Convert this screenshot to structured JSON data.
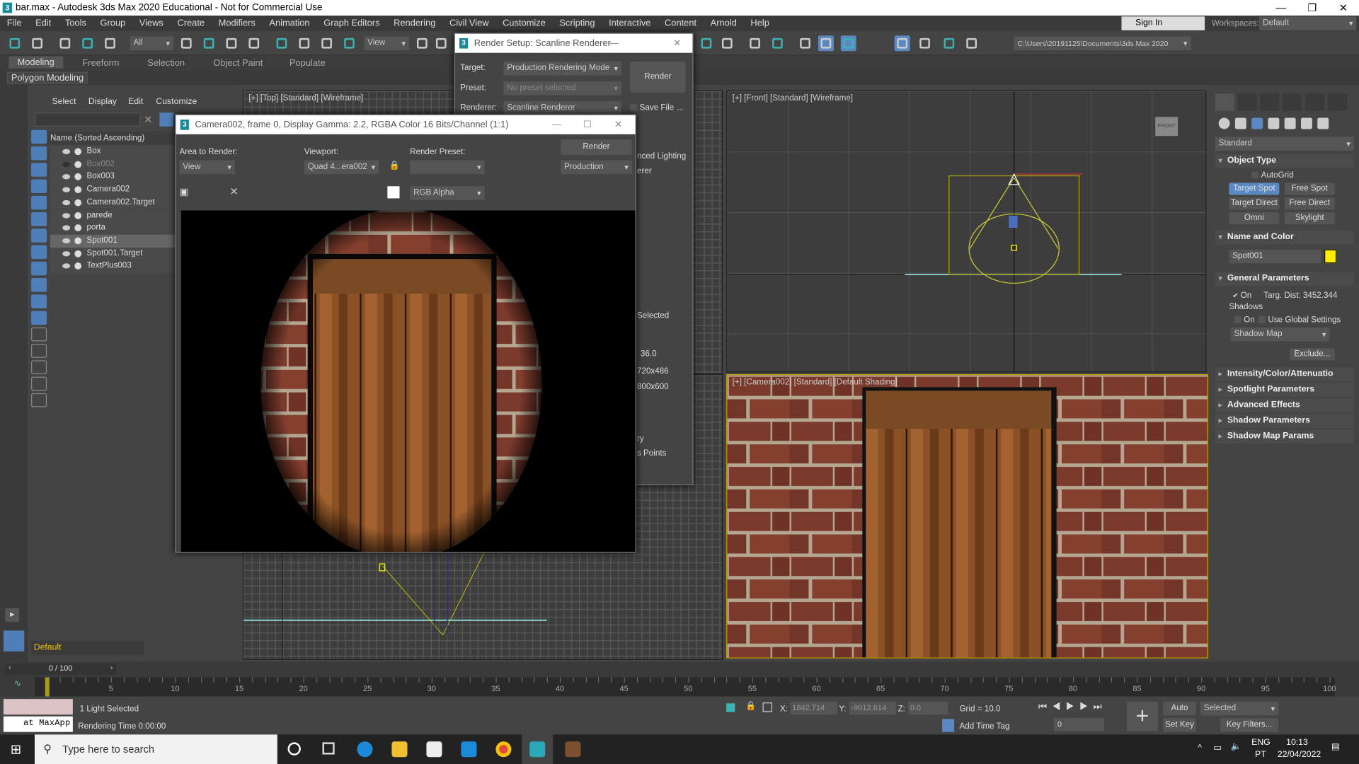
{
  "window": {
    "title": "bar.max - Autodesk 3ds Max 2020 Educational - Not for Commercial Use",
    "logo": "3"
  },
  "menu": [
    "File",
    "Edit",
    "Tools",
    "Group",
    "Views",
    "Create",
    "Modifiers",
    "Animation",
    "Graph Editors",
    "Rendering",
    "Civil View",
    "Customize",
    "Scripting",
    "Interactive",
    "Content",
    "Arnold",
    "Help"
  ],
  "account": {
    "sign_in": "Sign In",
    "workspaces_label": "Workspaces:",
    "workspace": "Default"
  },
  "toolbar": {
    "selection_filter": "All",
    "ref_coord": "View",
    "project_path": "C:\\Users\\20191125\\Documents\\3ds Max 2020",
    "icons": [
      "undo-icon",
      "redo-icon",
      "link-icon",
      "unlink-icon",
      "bind-space-warp-icon",
      "select-object-icon",
      "select-by-name-icon",
      "rect-selection-icon",
      "window-crossing-icon",
      "move-icon",
      "rotate-icon",
      "scale-icon",
      "snap-icon",
      "mirror-icon",
      "align-icon",
      "layer-explorer-icon",
      "toggle-ribbon-icon",
      "scene-explorer-icon",
      "curve-editor-icon",
      "schematic-view-icon",
      "material-editor-icon",
      "render-setup-icon",
      "rendered-frame-window-icon",
      "render-production-icon",
      "render-cloud-icon",
      "render-gallery-icon"
    ]
  },
  "ribbon": {
    "tabs": [
      "Modeling",
      "Freeform",
      "Selection",
      "Object Paint",
      "Populate"
    ],
    "active": "Modeling",
    "panel": "Polygon Modeling"
  },
  "explorer": {
    "menu": [
      "Select",
      "Display",
      "Edit",
      "Customize"
    ],
    "column": "Name (Sorted Ascending)",
    "items": [
      {
        "name": "Box",
        "state": "normal"
      },
      {
        "name": "Box002",
        "state": "hidden"
      },
      {
        "name": "Box003",
        "state": "normal"
      },
      {
        "name": "Camera002",
        "state": "normal"
      },
      {
        "name": "Camera002.Target",
        "state": "normal"
      },
      {
        "name": "parede",
        "state": "normal"
      },
      {
        "name": "porta",
        "state": "normal"
      },
      {
        "name": "Spot001",
        "state": "selected"
      },
      {
        "name": "Spot001.Target",
        "state": "normal"
      },
      {
        "name": "TextPlus003",
        "state": "normal"
      }
    ],
    "layer": "Default"
  },
  "viewports": {
    "top": "[+] [Top] [Standard] [Wireframe]",
    "front": "[+] [Front] [Standard] [Wireframe]",
    "camera": "[+] [Camera002] [Standard] [Default Shading]",
    "viewcube_front": "FRONT"
  },
  "render_setup": {
    "title": "Render Setup: Scanline Renderer",
    "target_label": "Target:",
    "target": "Production Rendering Mode",
    "preset_label": "Preset:",
    "preset": "No preset selected",
    "renderer_label": "Renderer:",
    "renderer": "Scanline Renderer",
    "render": "Render",
    "save_file": "Save File",
    "more": "...",
    "partial": {
      "lighting": "nced Lighting",
      "renderer": "erer",
      "selected": "Selected",
      "aperture": "36.0",
      "size1": "720x486",
      "size2": "800x600",
      "ry": "ry",
      "points": "s Points"
    }
  },
  "frame_window": {
    "title": "Camera002, frame 0, Display Gamma: 2.2, RGBA Color 16 Bits/Channel (1:1)",
    "area_label": "Area to Render:",
    "area": "View",
    "viewport_label": "Viewport:",
    "viewport": "Quad 4...era002",
    "preset_label": "Render Preset:",
    "preset": "",
    "render": "Render",
    "mode": "Production",
    "channel": "RGB Alpha",
    "colors": {
      "red": "#e02020",
      "green": "#30a040",
      "blue": "#20a0e0"
    }
  },
  "command_panel": {
    "category": "Standard",
    "object_type": "Object Type",
    "autogrid": "AutoGrid",
    "buttons": [
      "Target Spot",
      "Free Spot",
      "Target Direct",
      "Free Direct",
      "Omni",
      "Skylight"
    ],
    "active_button": "Target Spot",
    "name_and_color": "Name and Color",
    "object_name": "Spot001",
    "object_color": "#ffee00",
    "general": "General Parameters",
    "on": "On",
    "on_checked": true,
    "targ_dist": "Targ. Dist: 3452.344",
    "shadows": "Shadows",
    "shadows_on": "On",
    "use_global": "Use Global Settings",
    "shadow_type": "Shadow Map",
    "exclude": "Exclude...",
    "rollouts": [
      "Intensity/Color/Attenuatio",
      "Spotlight Parameters",
      "Advanced Effects",
      "Shadow Parameters",
      "Shadow Map Params"
    ]
  },
  "timeline": {
    "frame_display": "0 / 100",
    "start": 0,
    "end": 100,
    "current": 0,
    "label_step": 5
  },
  "status": {
    "script_listener": "at MaxApp",
    "selection": "1 Light Selected",
    "render_time": "Rendering Time  0:00:00",
    "x_label": "X:",
    "x": "1842.714",
    "y_label": "Y:",
    "y": "-9012.614",
    "z_label": "Z:",
    "z": "0.0",
    "grid": "Grid = 10.0",
    "add_time_tag": "Add Time Tag",
    "frame": "0",
    "auto_key": "Auto Key",
    "set_key": "Set Key",
    "key_mode": "Selected",
    "key_filters": "Key Filters..."
  },
  "taskbar": {
    "search": "Type here to search",
    "lang1": "ENG",
    "lang2": "PT",
    "time": "10:13",
    "date": "22/04/2022"
  }
}
